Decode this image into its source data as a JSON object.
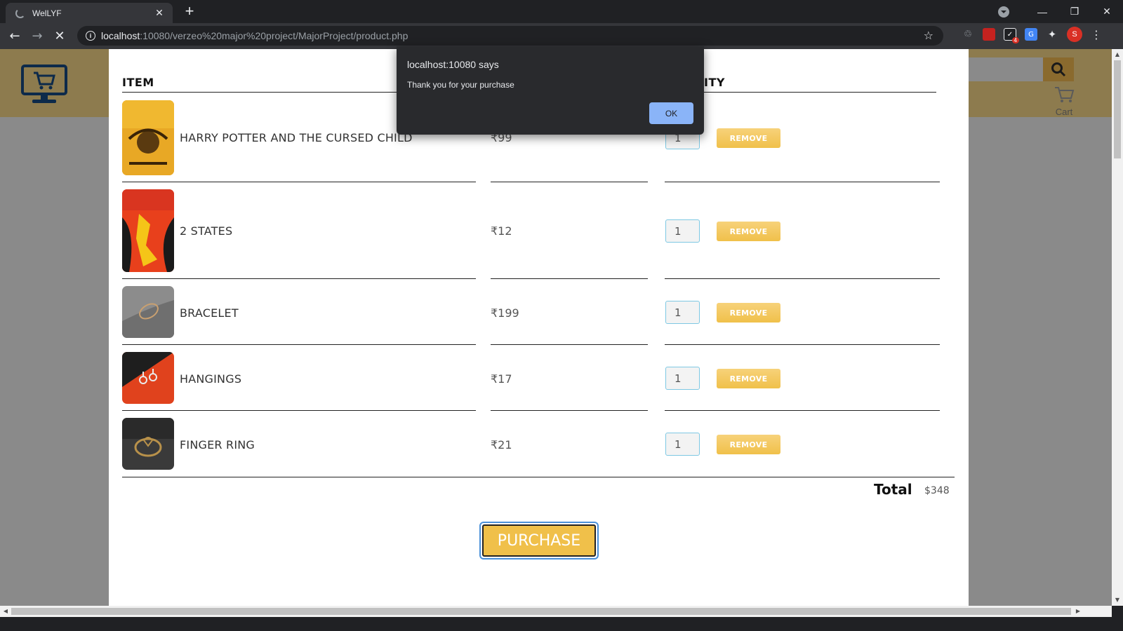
{
  "browser": {
    "tab_title": "WelLYF",
    "new_tab_symbol": "+",
    "url_host": "localhost",
    "url_path": ":10080/verzeo%20major%20project/MajorProject/product.php",
    "avatar_letter": "S",
    "ext_badge": "4"
  },
  "header": {
    "cart_label": "Cart"
  },
  "table": {
    "head_item": "ITEM",
    "head_qty": "ITY"
  },
  "items": [
    {
      "name": "HARRY POTTER AND THE CURSED CHILD",
      "price": "₹99",
      "qty": "1",
      "remove": "REMOVE",
      "thumb_color": "#e8a825"
    },
    {
      "name": "2 STATES",
      "price": "₹12",
      "qty": "1",
      "remove": "REMOVE",
      "thumb_color": "#e8401c"
    },
    {
      "name": "BRACELET",
      "price": "₹199",
      "qty": "1",
      "remove": "REMOVE",
      "thumb_color": "#8c8c8c"
    },
    {
      "name": "HANGINGS",
      "price": "₹17",
      "qty": "1",
      "remove": "REMOVE",
      "thumb_color": "#e0421d"
    },
    {
      "name": "FINGER RING",
      "price": "₹21",
      "qty": "1",
      "remove": "REMOVE",
      "thumb_color": "#3a3a3a"
    }
  ],
  "summary": {
    "total_label": "Total",
    "total_value": "$348",
    "purchase_label": "PURCHASE"
  },
  "dialog": {
    "title": "localhost:10080 says",
    "message": "Thank you for your purchase",
    "ok_label": "OK"
  },
  "colors": {
    "accent": "#f0c04a",
    "header_bg": "#8d7b4e",
    "dialog_bg": "#292a2d",
    "ok_button": "#8ab4f8"
  }
}
